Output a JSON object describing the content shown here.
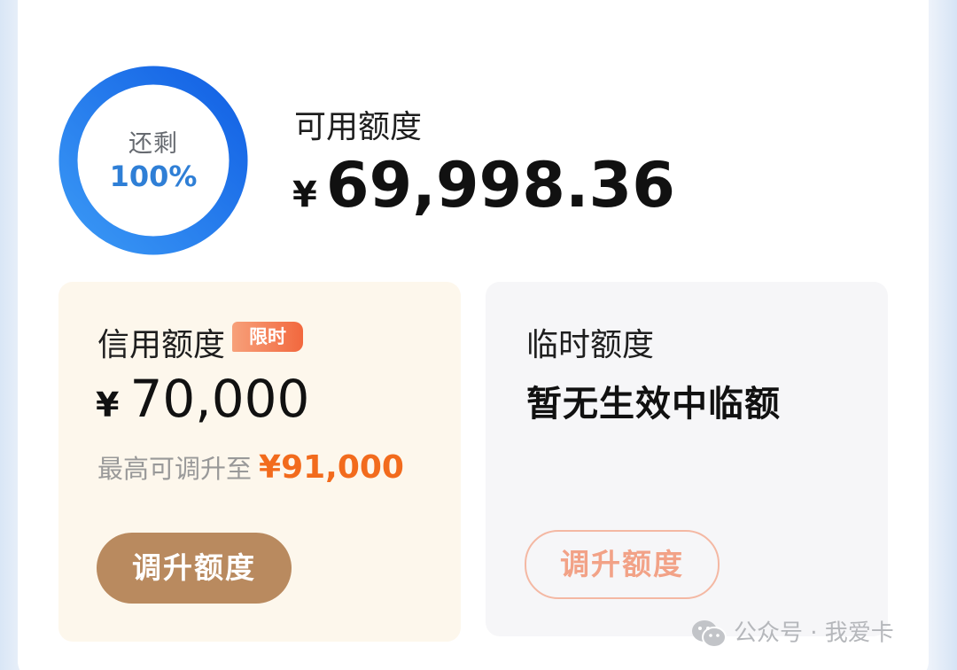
{
  "balance": {
    "ring_label": "还剩",
    "ring_value": "100%",
    "remaining_fraction": 1.0,
    "title": "可用额度",
    "currency": "¥",
    "amount": "69,998.36"
  },
  "credit": {
    "title": "信用额度",
    "badge": "限时",
    "currency": "¥",
    "amount": "70,000",
    "max_label": "最高可调升至",
    "max_value": "¥91,000",
    "button": "调升额度"
  },
  "temporary": {
    "title": "临时额度",
    "status": "暂无生效中临额",
    "button": "调升额度"
  },
  "watermark": {
    "icon": "wechat-icon",
    "text": "公众号 · 我爱卡"
  },
  "colors": {
    "ring_start": "#2f8cf2",
    "ring_end": "#1464e6",
    "accent_orange": "#f26b1d",
    "button_brown": "#b98a5f",
    "credit_panel_bg": "#fdf7ec"
  }
}
